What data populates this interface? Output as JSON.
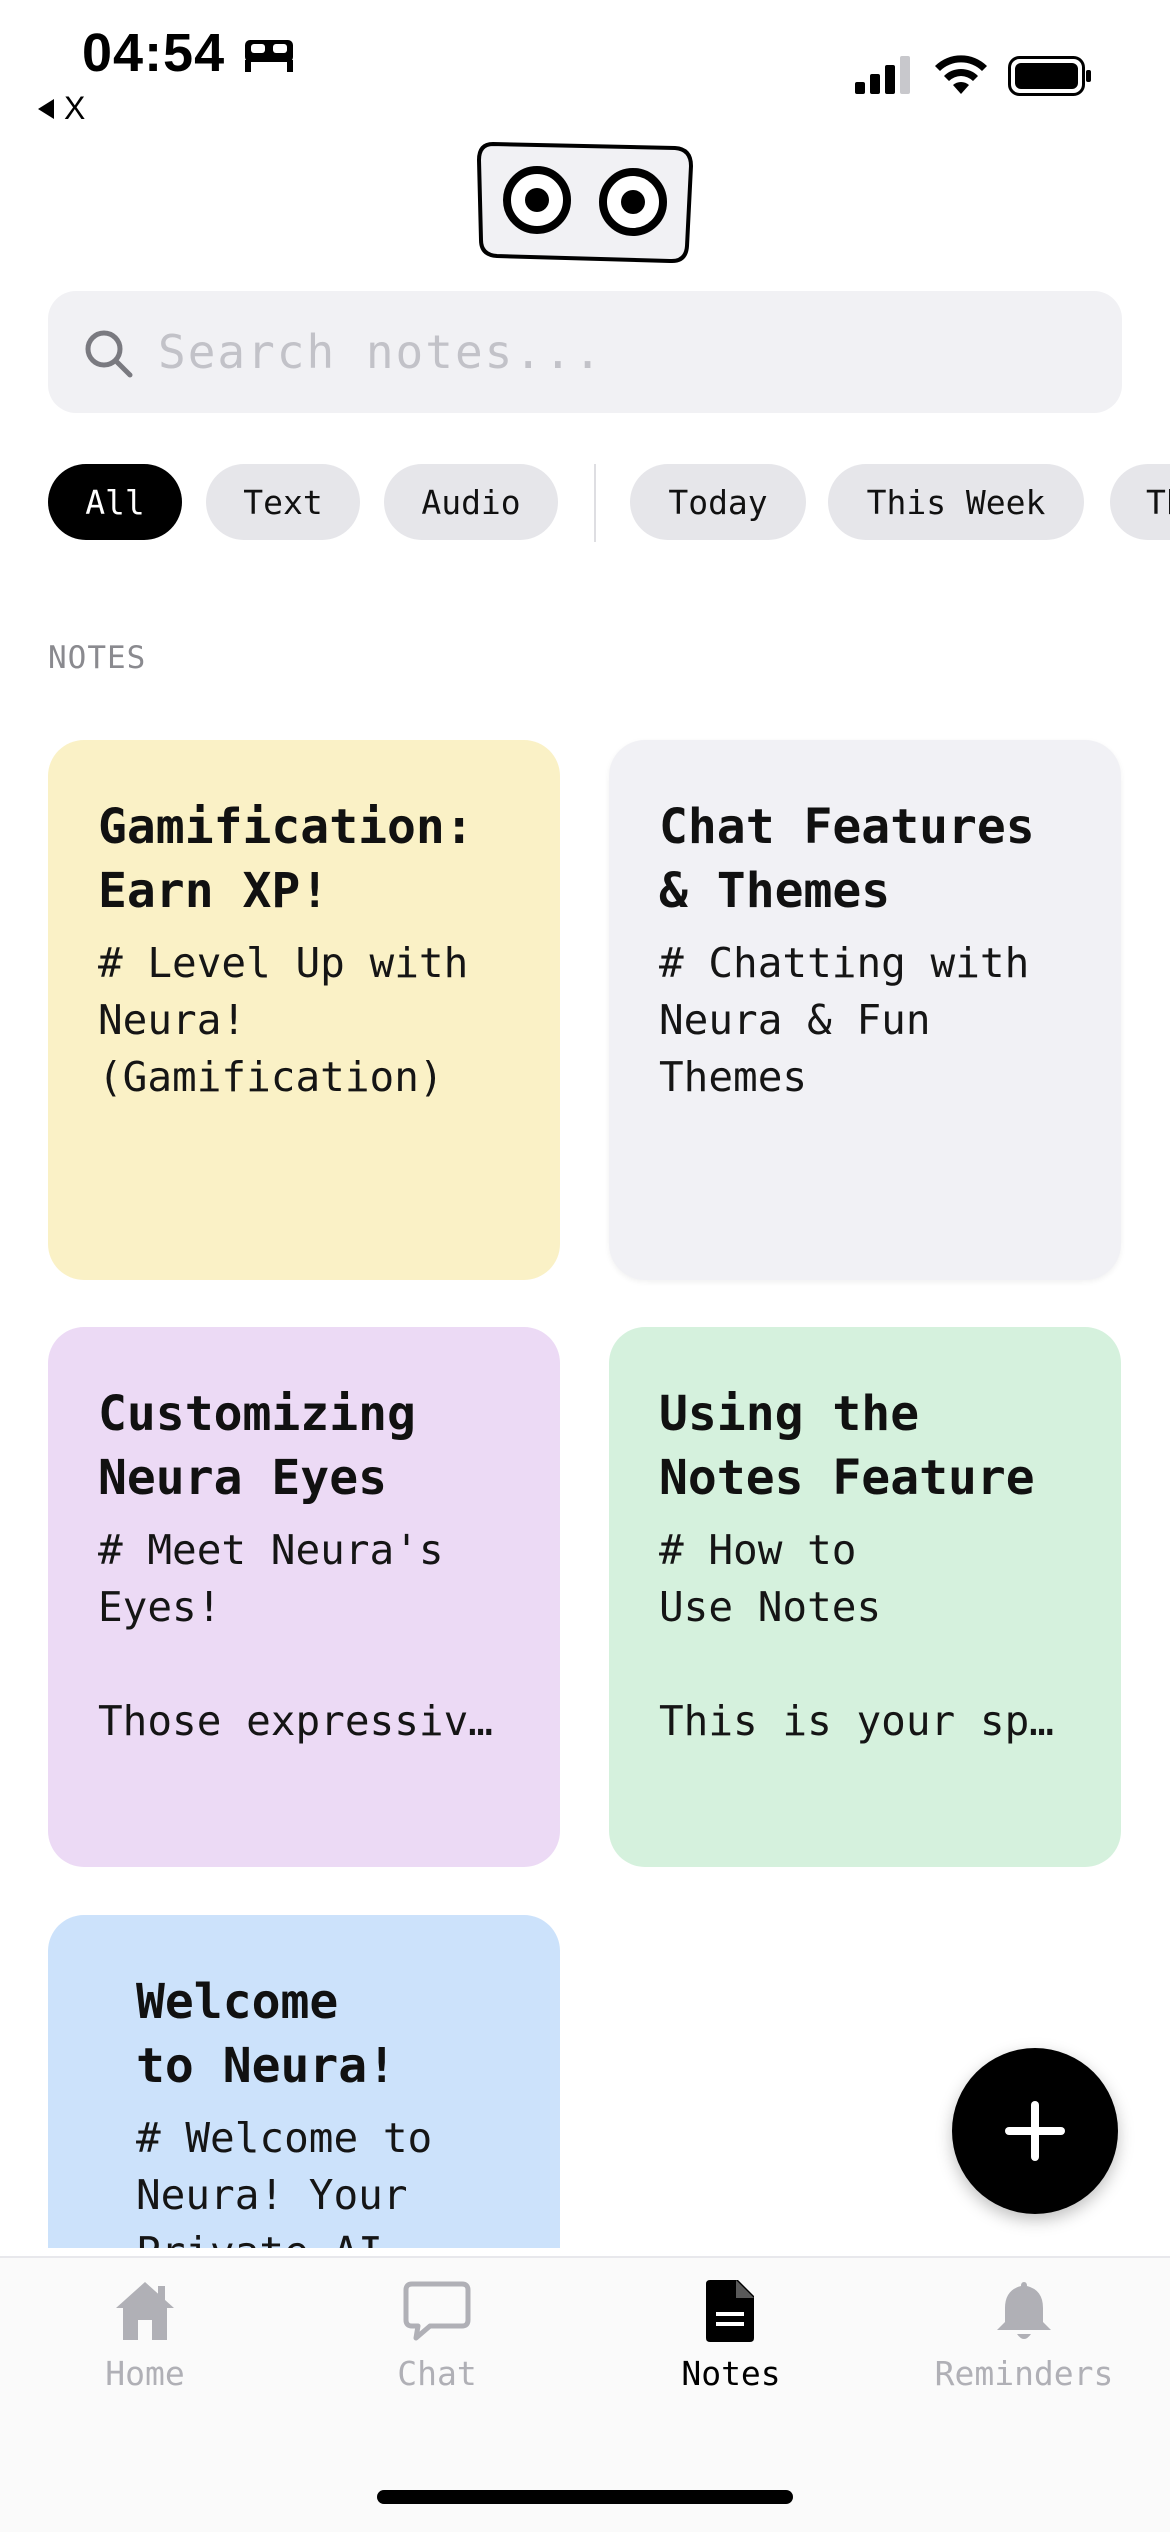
{
  "status_bar": {
    "time": "04:54",
    "back_label": "X"
  },
  "search": {
    "placeholder": "Search notes..."
  },
  "filters": {
    "items": [
      "All",
      "Text",
      "Audio",
      "Today",
      "This Week",
      "Th"
    ],
    "active": "All"
  },
  "section": {
    "label": "NOTES"
  },
  "notes": [
    {
      "title": "Gamification:\nEarn XP!",
      "preview": "# Level Up with\nNeura!\n(Gamification)",
      "color": "#faf1c6"
    },
    {
      "title": "Chat Features\n& Themes",
      "preview": "# Chatting with\nNeura & Fun\nThemes",
      "color": "#f1f1f5"
    },
    {
      "title": "Customizing\nNeura Eyes",
      "preview": "# Meet Neura's\nEyes!\n\nThose expressiv…",
      "color": "#ecdaf5"
    },
    {
      "title": "Using the\nNotes Feature",
      "preview": "# How to\nUse Notes\n\nThis is your sp…",
      "color": "#d5f1dd"
    },
    {
      "title": "Welcome\nto Neura!",
      "preview": "# Welcome to\nNeura! Your\nPrivate AI",
      "color": "#cce2fb"
    }
  ],
  "nav": {
    "items": [
      {
        "label": "Home",
        "icon": "home-icon"
      },
      {
        "label": "Chat",
        "icon": "chat-icon"
      },
      {
        "label": "Notes",
        "icon": "notes-icon"
      },
      {
        "label": "Reminders",
        "icon": "bell-icon"
      }
    ],
    "active": "Notes"
  },
  "fab": {
    "icon": "plus-icon"
  }
}
